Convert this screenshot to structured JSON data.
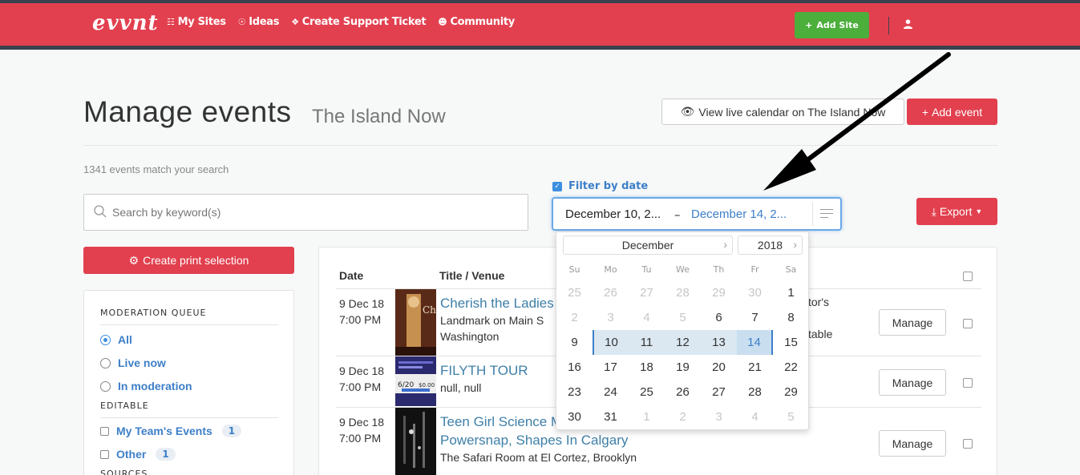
{
  "nav": {
    "logo": "evvnt",
    "links": [
      {
        "label": "My Sites",
        "icon": "sitemap-icon"
      },
      {
        "label": "Ideas",
        "icon": "lightbulb-icon"
      },
      {
        "label": "Create Support Ticket",
        "icon": "ticket-icon"
      },
      {
        "label": "Community",
        "icon": "users-icon"
      }
    ],
    "add_site": "Add Site",
    "user_icon": "user-icon"
  },
  "header": {
    "title": "Manage events",
    "subtitle": "The Island Now",
    "view_live": "View live calendar on The Island Now",
    "add_event": "Add event"
  },
  "search": {
    "match_count": "1341 events match your search",
    "placeholder": "Search by keyword(s)",
    "value": ""
  },
  "filter": {
    "label": "Filter by date",
    "checked": true,
    "start": "December 10, 2...",
    "dash": "–",
    "end": "December 14, 2..."
  },
  "export": "Export",
  "print_selection": "Create print selection",
  "sidebar": {
    "moderation_heading": "MODERATION QUEUE",
    "moderation": [
      {
        "label": "All",
        "selected": true
      },
      {
        "label": "Live now",
        "selected": false
      },
      {
        "label": "In moderation",
        "selected": false
      }
    ],
    "editable_heading": "EDITABLE",
    "editable": [
      {
        "label": "My Team's Events",
        "count": "1"
      },
      {
        "label": "Other",
        "count": "1"
      }
    ],
    "sources_heading": "SOURCES"
  },
  "table": {
    "col_date": "Date",
    "col_title": "Title / Venue",
    "manage_label": "Manage",
    "rows": [
      {
        "date": "9 Dec 18",
        "time": "7:00 PM",
        "title": "Cherish the Ladies",
        "venue1": "Landmark on Main S",
        "venue2": "Washington",
        "extra1": "tor's",
        "extra2": "table"
      },
      {
        "date": "9 Dec 18",
        "time": "7:00 PM",
        "title": "FILYTH TOUR",
        "venue1": "null, null",
        "venue2": ""
      },
      {
        "date": "9 Dec 18",
        "time": "7:00 PM",
        "title": "Teen Girl Science M",
        "title2": "Powersnap, Shapes In Calgary",
        "venue1": "The Safari Room at El Cortez, Brooklyn"
      }
    ]
  },
  "calendar": {
    "month": "December",
    "year": "2018",
    "weekdays": [
      "Su",
      "Mo",
      "Tu",
      "We",
      "Th",
      "Fr",
      "Sa"
    ],
    "weeks": [
      [
        "25",
        "26",
        "27",
        "28",
        "29",
        "30",
        "1"
      ],
      [
        "2",
        "3",
        "4",
        "5",
        "6",
        "7",
        "8"
      ],
      [
        "9",
        "10",
        "11",
        "12",
        "13",
        "14",
        "15"
      ],
      [
        "16",
        "17",
        "18",
        "19",
        "20",
        "21",
        "22"
      ],
      [
        "23",
        "24",
        "25",
        "26",
        "27",
        "28",
        "29"
      ],
      [
        "30",
        "31",
        "1",
        "2",
        "3",
        "4",
        "5"
      ]
    ]
  },
  "colors": {
    "brand": "#e2404f",
    "nav_dark": "#39424e",
    "green": "#4cae3b",
    "link": "#3d7fc8"
  }
}
